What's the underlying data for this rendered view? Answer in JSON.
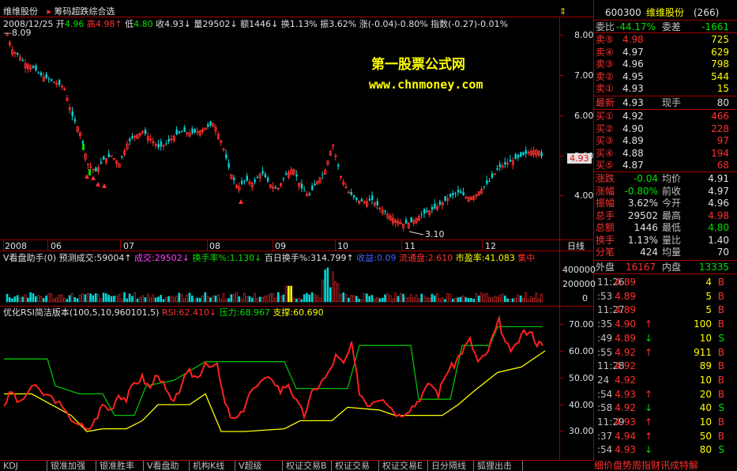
{
  "header": {
    "stock_name": "维维股份",
    "indicator_name": "筹码超跌综合选",
    "date": "2008/12/25",
    "open_label": "开",
    "open": "4.96",
    "high_label": "高",
    "high": "4.98",
    "low_label": "低",
    "low": "4.80",
    "close_label": "收",
    "close": "4.93",
    "volume_label": "量",
    "volume": "29502",
    "amount_label": "额",
    "amount": "1446",
    "turnover_label": "换",
    "turnover": "1.13%",
    "amplitude_label": "振",
    "amplitude": "3.62%",
    "change_label": "涨",
    "change": "(-0.04)-0.80%",
    "index_label": "指数",
    "index": "(-0.27)-0.01%",
    "high_marker": "8.09"
  },
  "watermark": {
    "line1": "第一股票公式网",
    "line2": "www.chnmoney.com"
  },
  "price_axis": {
    "ticks": [
      "8.00",
      "7.00",
      "6.00",
      "5.00",
      "4.00"
    ],
    "current": "4.93"
  },
  "low_marker": "3.10",
  "date_axis": {
    "labels": [
      "2008",
      "06",
      "07",
      "08",
      "09",
      "10",
      "11",
      "12"
    ],
    "period": "日线"
  },
  "volume_panel": {
    "title": "V看盘助手(0)",
    "predict_label": "预测成交",
    "predict": "59004",
    "vol_label": "成交",
    "vol": "29502",
    "turnover_label": "换手率%",
    "turnover": "1.130",
    "hundred_label": "百日换手%",
    "hundred": "314.799",
    "profit_label": "收益",
    "profit": "0.09",
    "float_label": "流通盘",
    "float": "2.610",
    "pe_label": "市盈率",
    "pe": "41.083",
    "tail": "集中",
    "ticks": [
      "400000",
      "200000",
      "0"
    ]
  },
  "rsi_panel": {
    "title": "优化RSI简洁版本(100,5,10,960101,5)",
    "rsi_label": "RSI",
    "rsi": "62.410",
    "pressure_label": "压力",
    "pressure": "68.967",
    "support_label": "支撑",
    "support": "60.690",
    "ticks": [
      "70.00",
      "60.00",
      "50.00",
      "40.00",
      "30.00"
    ]
  },
  "quote": {
    "code": "600300",
    "name": "维维股份",
    "count": "(266)",
    "weibi_label": "委比",
    "weibi": "-44.17%",
    "weicha_label": "委差",
    "weicha": "-1661",
    "asks": [
      {
        "label": "卖⑤",
        "price": "4.98",
        "vol": "725"
      },
      {
        "label": "卖④",
        "price": "4.97",
        "vol": "629"
      },
      {
        "label": "卖③",
        "price": "4.96",
        "vol": "798"
      },
      {
        "label": "卖②",
        "price": "4.95",
        "vol": "544"
      },
      {
        "label": "卖①",
        "price": "4.93",
        "vol": "15"
      }
    ],
    "last_label": "最新",
    "last": "4.93",
    "hand_label": "现手",
    "hand": "80",
    "bids": [
      {
        "label": "买①",
        "price": "4.92",
        "vol": "466"
      },
      {
        "label": "买②",
        "price": "4.90",
        "vol": "228"
      },
      {
        "label": "买③",
        "price": "4.89",
        "vol": "97"
      },
      {
        "label": "买④",
        "price": "4.88",
        "vol": "194"
      },
      {
        "label": "买⑤",
        "price": "4.87",
        "vol": "68"
      }
    ],
    "stats": [
      {
        "l1": "涨跌",
        "v1": "-0.04",
        "l2": "均价",
        "v2": "4.91"
      },
      {
        "l1": "涨幅",
        "v1": "-0.80%",
        "l2": "前收",
        "v2": "4.97"
      },
      {
        "l1": "振幅",
        "v1": "3.62%",
        "l2": "今开",
        "v2": "4.96"
      },
      {
        "l1": "总手",
        "v1": "29502",
        "l2": "最高",
        "v2": "4.98"
      },
      {
        "l1": "总额",
        "v1": "1446",
        "l2": "最低",
        "v2": "4.80"
      },
      {
        "l1": "换手",
        "v1": "1.13%",
        "l2": "量比",
        "v2": "1.40"
      },
      {
        "l1": "分笔",
        "v1": "424",
        "l2": "均量",
        "v2": "70"
      }
    ],
    "outer_label": "外盘",
    "outer": "16167",
    "inner_label": "内盘",
    "inner": "13335"
  },
  "ticks": [
    {
      "time": "11:26",
      "price": "4.89",
      "arrow": "",
      "vol": "4",
      "side": "B"
    },
    {
      "time": ":53",
      "price": "4.89",
      "arrow": "",
      "vol": "5",
      "side": "B"
    },
    {
      "time": "11:27",
      "price": "4.89",
      "arrow": "",
      "vol": "5",
      "side": "B"
    },
    {
      "time": ":35",
      "price": "4.90",
      "arrow": "↑",
      "vol": "100",
      "side": "B"
    },
    {
      "time": ":49",
      "price": "4.89",
      "arrow": "↓",
      "vol": "10",
      "side": "S"
    },
    {
      "time": ":55",
      "price": "4.92",
      "arrow": "↑",
      "vol": "911",
      "side": "B"
    },
    {
      "time": "11:28",
      "price": "4.92",
      "arrow": "",
      "vol": "89",
      "side": "B"
    },
    {
      "time": "24",
      "price": "4.92",
      "arrow": "",
      "vol": "10",
      "side": "B"
    },
    {
      "time": ":54",
      "price": "4.93",
      "arrow": "↑",
      "vol": "20",
      "side": "B"
    },
    {
      "time": ":58",
      "price": "4.92",
      "arrow": "↓",
      "vol": "40",
      "side": "S"
    },
    {
      "time": "11:29",
      "price": "4.93",
      "arrow": "↑",
      "vol": "10",
      "side": "B"
    },
    {
      "time": ":37",
      "price": "4.94",
      "arrow": "↑",
      "vol": "50",
      "side": "B"
    },
    {
      "time": ":54",
      "price": "4.93",
      "arrow": "↓",
      "vol": "80",
      "side": "S"
    }
  ],
  "tabs": [
    "KDJ",
    "银准加强",
    "银准胜率",
    "V看盘助手",
    "机构K线(修",
    "V超级MACD",
    "权证交易B",
    "权证交易C",
    "权证交易E",
    "日分隔线",
    "狐狸出击"
  ],
  "bottom_right": "细价盘势周指财讯成特解",
  "colors": {
    "up": "#ff3030",
    "down": "#00d8d8",
    "grid": "#800000",
    "rsi": "#ff2020",
    "pressure": "#00c000",
    "support": "#ffff00"
  }
}
